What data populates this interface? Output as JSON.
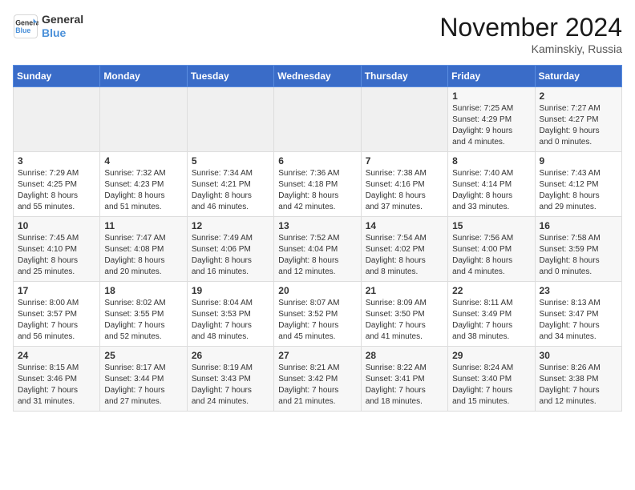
{
  "header": {
    "logo_line1": "General",
    "logo_line2": "Blue",
    "month_title": "November 2024",
    "location": "Kaminskiy, Russia"
  },
  "days_of_week": [
    "Sunday",
    "Monday",
    "Tuesday",
    "Wednesday",
    "Thursday",
    "Friday",
    "Saturday"
  ],
  "weeks": [
    [
      {
        "day": "",
        "info": ""
      },
      {
        "day": "",
        "info": ""
      },
      {
        "day": "",
        "info": ""
      },
      {
        "day": "",
        "info": ""
      },
      {
        "day": "",
        "info": ""
      },
      {
        "day": "1",
        "info": "Sunrise: 7:25 AM\nSunset: 4:29 PM\nDaylight: 9 hours\nand 4 minutes."
      },
      {
        "day": "2",
        "info": "Sunrise: 7:27 AM\nSunset: 4:27 PM\nDaylight: 9 hours\nand 0 minutes."
      }
    ],
    [
      {
        "day": "3",
        "info": "Sunrise: 7:29 AM\nSunset: 4:25 PM\nDaylight: 8 hours\nand 55 minutes."
      },
      {
        "day": "4",
        "info": "Sunrise: 7:32 AM\nSunset: 4:23 PM\nDaylight: 8 hours\nand 51 minutes."
      },
      {
        "day": "5",
        "info": "Sunrise: 7:34 AM\nSunset: 4:21 PM\nDaylight: 8 hours\nand 46 minutes."
      },
      {
        "day": "6",
        "info": "Sunrise: 7:36 AM\nSunset: 4:18 PM\nDaylight: 8 hours\nand 42 minutes."
      },
      {
        "day": "7",
        "info": "Sunrise: 7:38 AM\nSunset: 4:16 PM\nDaylight: 8 hours\nand 37 minutes."
      },
      {
        "day": "8",
        "info": "Sunrise: 7:40 AM\nSunset: 4:14 PM\nDaylight: 8 hours\nand 33 minutes."
      },
      {
        "day": "9",
        "info": "Sunrise: 7:43 AM\nSunset: 4:12 PM\nDaylight: 8 hours\nand 29 minutes."
      }
    ],
    [
      {
        "day": "10",
        "info": "Sunrise: 7:45 AM\nSunset: 4:10 PM\nDaylight: 8 hours\nand 25 minutes."
      },
      {
        "day": "11",
        "info": "Sunrise: 7:47 AM\nSunset: 4:08 PM\nDaylight: 8 hours\nand 20 minutes."
      },
      {
        "day": "12",
        "info": "Sunrise: 7:49 AM\nSunset: 4:06 PM\nDaylight: 8 hours\nand 16 minutes."
      },
      {
        "day": "13",
        "info": "Sunrise: 7:52 AM\nSunset: 4:04 PM\nDaylight: 8 hours\nand 12 minutes."
      },
      {
        "day": "14",
        "info": "Sunrise: 7:54 AM\nSunset: 4:02 PM\nDaylight: 8 hours\nand 8 minutes."
      },
      {
        "day": "15",
        "info": "Sunrise: 7:56 AM\nSunset: 4:00 PM\nDaylight: 8 hours\nand 4 minutes."
      },
      {
        "day": "16",
        "info": "Sunrise: 7:58 AM\nSunset: 3:59 PM\nDaylight: 8 hours\nand 0 minutes."
      }
    ],
    [
      {
        "day": "17",
        "info": "Sunrise: 8:00 AM\nSunset: 3:57 PM\nDaylight: 7 hours\nand 56 minutes."
      },
      {
        "day": "18",
        "info": "Sunrise: 8:02 AM\nSunset: 3:55 PM\nDaylight: 7 hours\nand 52 minutes."
      },
      {
        "day": "19",
        "info": "Sunrise: 8:04 AM\nSunset: 3:53 PM\nDaylight: 7 hours\nand 48 minutes."
      },
      {
        "day": "20",
        "info": "Sunrise: 8:07 AM\nSunset: 3:52 PM\nDaylight: 7 hours\nand 45 minutes."
      },
      {
        "day": "21",
        "info": "Sunrise: 8:09 AM\nSunset: 3:50 PM\nDaylight: 7 hours\nand 41 minutes."
      },
      {
        "day": "22",
        "info": "Sunrise: 8:11 AM\nSunset: 3:49 PM\nDaylight: 7 hours\nand 38 minutes."
      },
      {
        "day": "23",
        "info": "Sunrise: 8:13 AM\nSunset: 3:47 PM\nDaylight: 7 hours\nand 34 minutes."
      }
    ],
    [
      {
        "day": "24",
        "info": "Sunrise: 8:15 AM\nSunset: 3:46 PM\nDaylight: 7 hours\nand 31 minutes."
      },
      {
        "day": "25",
        "info": "Sunrise: 8:17 AM\nSunset: 3:44 PM\nDaylight: 7 hours\nand 27 minutes."
      },
      {
        "day": "26",
        "info": "Sunrise: 8:19 AM\nSunset: 3:43 PM\nDaylight: 7 hours\nand 24 minutes."
      },
      {
        "day": "27",
        "info": "Sunrise: 8:21 AM\nSunset: 3:42 PM\nDaylight: 7 hours\nand 21 minutes."
      },
      {
        "day": "28",
        "info": "Sunrise: 8:22 AM\nSunset: 3:41 PM\nDaylight: 7 hours\nand 18 minutes."
      },
      {
        "day": "29",
        "info": "Sunrise: 8:24 AM\nSunset: 3:40 PM\nDaylight: 7 hours\nand 15 minutes."
      },
      {
        "day": "30",
        "info": "Sunrise: 8:26 AM\nSunset: 3:38 PM\nDaylight: 7 hours\nand 12 minutes."
      }
    ]
  ]
}
